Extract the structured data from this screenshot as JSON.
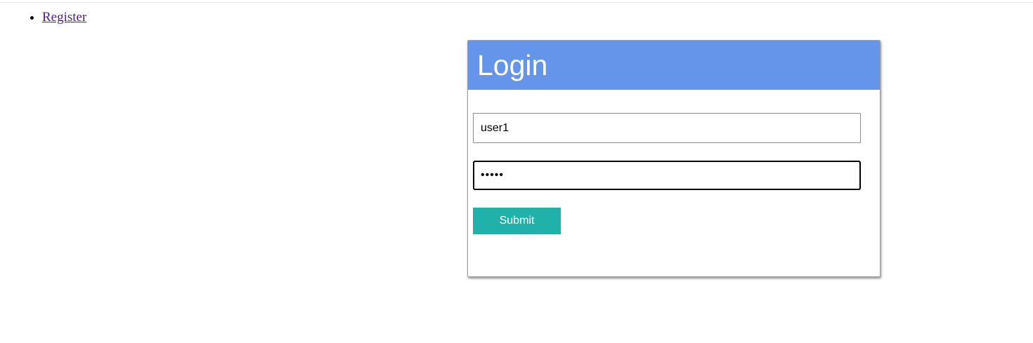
{
  "nav": {
    "items": [
      {
        "label": "Register"
      }
    ]
  },
  "login": {
    "title": "Login",
    "username_value": "user1",
    "password_value": "•••••",
    "submit_label": "Submit"
  },
  "colors": {
    "header_accent": "#6595eb",
    "submit_button": "#20b2aa",
    "link_visited": "#551a8b"
  }
}
